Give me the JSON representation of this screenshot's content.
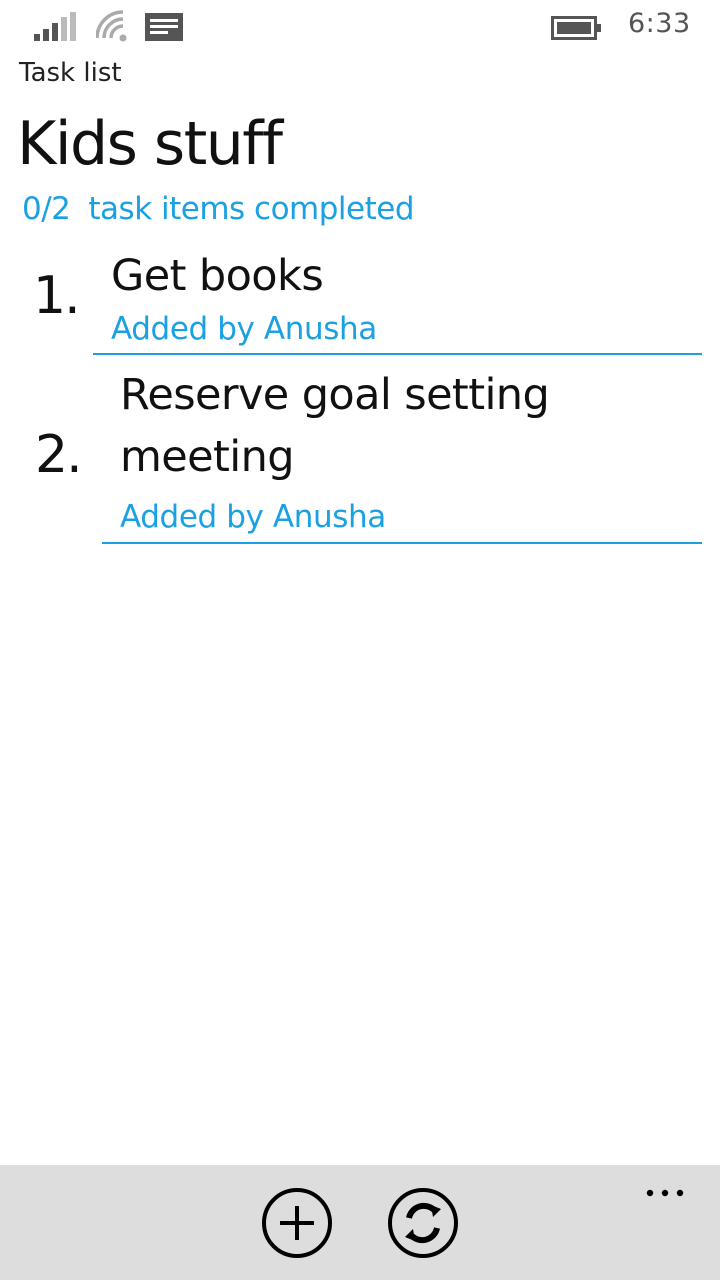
{
  "status_bar": {
    "time": "6:33",
    "icons": [
      "signal-icon",
      "wifi-icon",
      "message-icon",
      "battery-icon"
    ]
  },
  "header": {
    "app_name": "Task list",
    "list_title": "Kids stuff",
    "progress": {
      "count": "0/2",
      "label": "task items completed"
    }
  },
  "tasks": [
    {
      "number": "1.",
      "title": "Get books",
      "author": "Added by Anusha"
    },
    {
      "number": "2.",
      "title": "Reserve goal setting meeting",
      "author": "Added by Anusha"
    }
  ],
  "app_bar": {
    "buttons": [
      "add-icon",
      "sync-icon"
    ],
    "more": "more-icon"
  },
  "colors": {
    "accent": "#1ba1e2",
    "app_bar_background": "#dddddd",
    "background": "#ffffff"
  }
}
